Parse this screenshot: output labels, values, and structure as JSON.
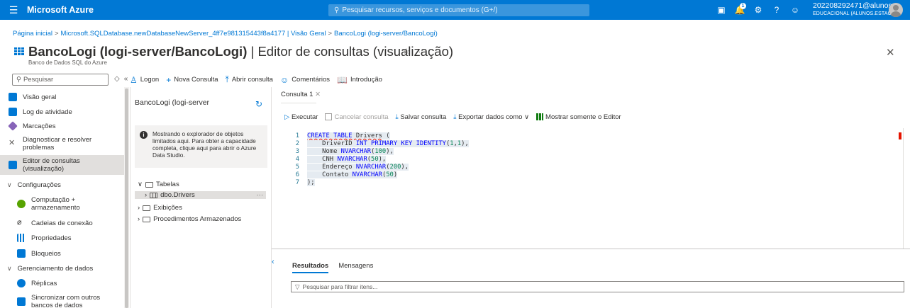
{
  "topbar": {
    "brand": "Microsoft Azure",
    "search_placeholder": "Pesquisar recursos, serviços e documentos (G+/)",
    "notification_count": "1",
    "account_email": "202208292471@alunos....",
    "account_tenant": "EDUCACIONAL (ALUNOS.ESTACI..."
  },
  "breadcrumb": {
    "items": [
      "Página inicial",
      "Microsoft.SQLDatabase.newDatabaseNewServer_4ff7e981315443f8a4177 | Visão Geral",
      "BancoLogi (logi-server/BancoLogi)"
    ],
    "separator": ">"
  },
  "header": {
    "title_bold": "BancoLogi (logi-server/BancoLogi)",
    "title_rest": " | Editor de consultas (visualização)",
    "star": "☆",
    "ellipsis": "···",
    "subtitle": "Banco de Dados SQL do Azure",
    "close": "✕"
  },
  "left_search": {
    "placeholder": "Pesquisar"
  },
  "toolbar": {
    "logon": "Logon",
    "new_query": "Nova Consulta",
    "open_query": "Abrir consulta",
    "feedback": "Comentários",
    "intro": "Introdução"
  },
  "nav": {
    "items": [
      {
        "label": "Visão geral"
      },
      {
        "label": "Log de atividade"
      },
      {
        "label": "Marcações"
      },
      {
        "label": "Diagnosticar e resolver problemas"
      },
      {
        "label": "Editor de consultas (visualização)"
      },
      {
        "label": "Configurações"
      },
      {
        "label": "Computação + armazenamento"
      },
      {
        "label": "Cadeias de conexão"
      },
      {
        "label": "Propriedades"
      },
      {
        "label": "Bloqueios"
      },
      {
        "label": "Gerenciamento de dados"
      },
      {
        "label": "Réplicas"
      },
      {
        "label": "Sincronizar com outros bancos de dados"
      }
    ]
  },
  "explorer": {
    "title": "BancoLogi (logi-server",
    "info": "Mostrando o explorador de objetos limitados aqui. Para obter a capacidade completa, clique aqui para abrir o Azure Data Studio.",
    "tree": [
      {
        "label": "Tabelas"
      },
      {
        "label": "dbo.Drivers"
      },
      {
        "label": "Exibições"
      },
      {
        "label": "Procedimentos Armazenados"
      }
    ],
    "more": "···"
  },
  "editor": {
    "tab_label": "Consulta 1",
    "run": "Executar",
    "cancel": "Cancelar consulta",
    "save": "Salvar consulta",
    "export": "Exportar dados como",
    "show_editor_only": "Mostrar somente o Editor",
    "lines": [
      {
        "n": "1",
        "tokens": [
          [
            "kw sq",
            "CREATE TABLE "
          ],
          [
            "sq",
            "Drivers"
          ],
          [
            "",
            " ("
          ]
        ]
      },
      {
        "n": "2",
        "tokens": [
          [
            "",
            "    DriverID "
          ],
          [
            "kw",
            "INT PRIMARY KEY IDENTITY"
          ],
          [
            "",
            "("
          ],
          [
            "num",
            "1"
          ],
          [
            "",
            ","
          ],
          [
            "num",
            "1"
          ],
          [
            "",
            "),"
          ]
        ]
      },
      {
        "n": "3",
        "tokens": [
          [
            "",
            "    Nome "
          ],
          [
            "kw",
            "NVARCHAR"
          ],
          [
            "",
            "("
          ],
          [
            "num",
            "100"
          ],
          [
            "",
            "),"
          ]
        ]
      },
      {
        "n": "4",
        "tokens": [
          [
            "",
            "    CNH "
          ],
          [
            "kw",
            "NVARCHAR"
          ],
          [
            "",
            "("
          ],
          [
            "num",
            "50"
          ],
          [
            "",
            "),"
          ]
        ]
      },
      {
        "n": "5",
        "tokens": [
          [
            "",
            "    Endereço "
          ],
          [
            "kw",
            "NVARCHAR"
          ],
          [
            "",
            "("
          ],
          [
            "num",
            "200"
          ],
          [
            "",
            "),"
          ]
        ]
      },
      {
        "n": "6",
        "tokens": [
          [
            "",
            "    Contato "
          ],
          [
            "kw",
            "NVARCHAR"
          ],
          [
            "",
            "("
          ],
          [
            "num",
            "50"
          ],
          [
            "",
            ")"
          ]
        ]
      },
      {
        "n": "7",
        "tokens": [
          [
            "",
            ");"
          ]
        ]
      }
    ]
  },
  "results": {
    "tab_results": "Resultados",
    "tab_messages": "Mensagens",
    "filter_placeholder": "Pesquisar para filtrar itens..."
  },
  "colors": {
    "accent": "#0078d4",
    "topbar": "#0078d4",
    "error": "#e51400"
  }
}
